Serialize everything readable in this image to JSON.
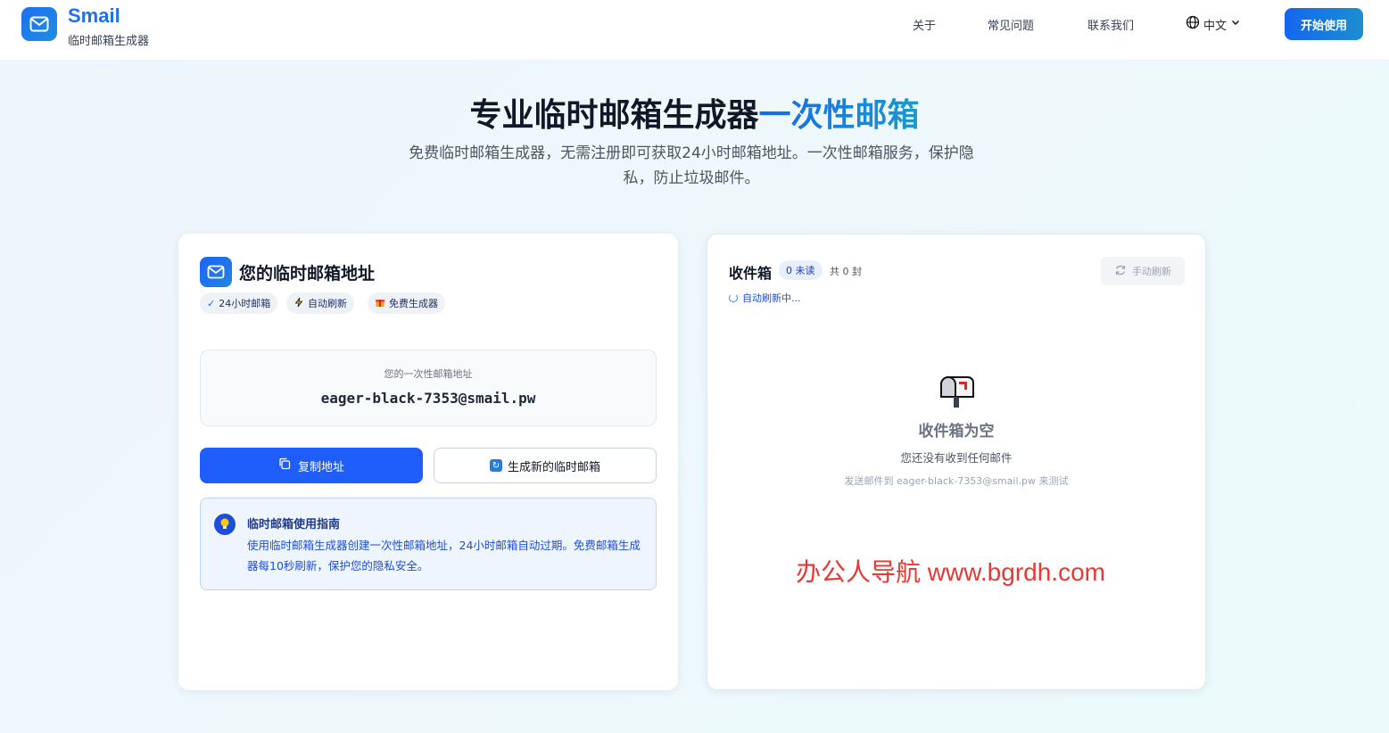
{
  "header": {
    "brand": "Smail",
    "brand_sub": "临时邮箱生成器",
    "nav": [
      "关于",
      "常见问题",
      "联系我们"
    ],
    "lang": "中文",
    "start_button": "开始使用"
  },
  "hero": {
    "title_main": "专业临时邮箱生成器",
    "title_accent": "一次性邮箱",
    "desc_line1": "免费临时邮箱生成器，无需注册即可获取24小时邮箱地址。一次性邮箱服务，保护隐",
    "desc_line2": "私，防止垃圾邮件。"
  },
  "address_card": {
    "title": "您的临时邮箱地址",
    "tags": [
      "24小时邮箱",
      "自动刷新",
      "免费生成器"
    ],
    "address_label": "您的一次性邮箱地址",
    "address": "eager-black-7353@smail.pw",
    "copy_button": "复制地址",
    "new_button": "生成新的临时邮箱",
    "guide_title": "临时邮箱使用指南",
    "guide_text": "使用临时邮箱生成器创建一次性邮箱地址，24小时邮箱自动过期。免费邮箱生成器每10秒刷新，保护您的隐私安全。"
  },
  "inbox": {
    "title": "收件箱",
    "unread": "0 未读",
    "total": "共 0 封",
    "manual_refresh": "手动刷新",
    "auto_refresh": "自动刷新中...",
    "empty_title": "收件箱为空",
    "empty_sub": "您还没有收到任何邮件",
    "empty_hint": "发送邮件到 eager-black-7353@smail.pw 来测试"
  },
  "watermark": "办公人导航 www.bgrdh.com",
  "colors": {
    "primary": "#1f5efa",
    "accent_gradient_start": "#1668ee",
    "accent_gradient_end": "#1a9ac9",
    "watermark": "#e53935"
  },
  "icons": [
    "mail-icon",
    "globe-icon",
    "chevron-down-icon",
    "check-icon",
    "lightning-icon",
    "gift-icon",
    "copy-icon",
    "refresh-icon",
    "lightbulb-icon",
    "mailbox-icon",
    "spinner-icon"
  ]
}
